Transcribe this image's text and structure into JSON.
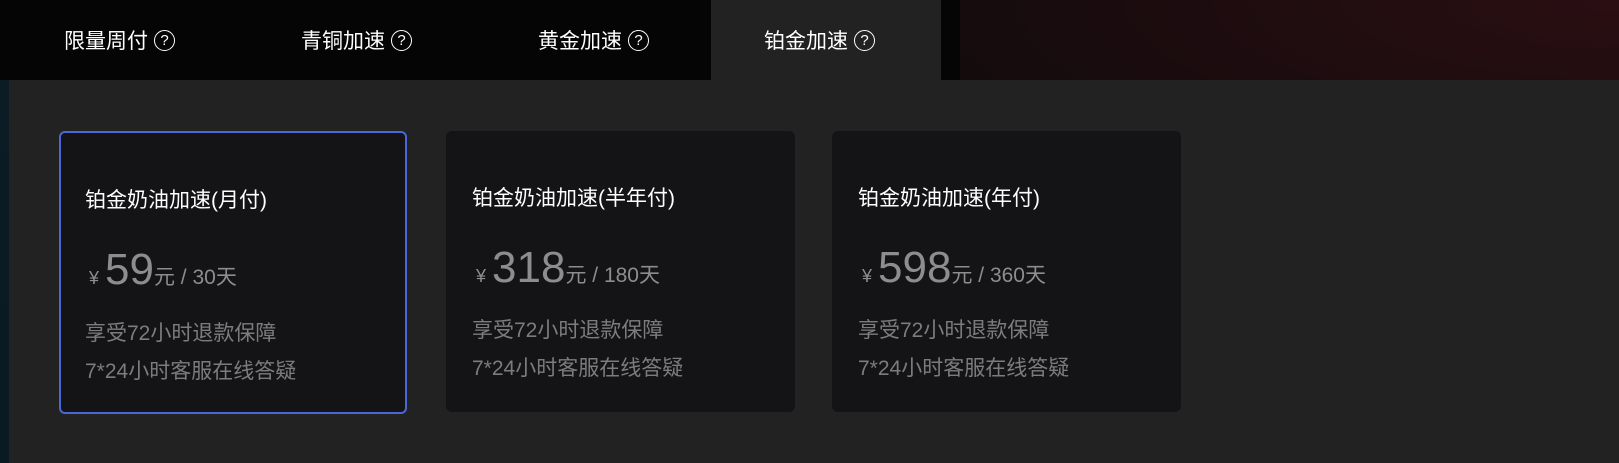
{
  "tabs": [
    {
      "label": "限量周付",
      "help": "?"
    },
    {
      "label": "青铜加速",
      "help": "?"
    },
    {
      "label": "黄金加速",
      "help": "?"
    },
    {
      "label": "铂金加速",
      "help": "?"
    }
  ],
  "active_tab": "铂金加速",
  "plans": [
    {
      "title": "铂金奶油加速(月付)",
      "currency": "¥",
      "price": "59",
      "unit": "元 / 30天",
      "features": [
        "享受72小时退款保障",
        "7*24小时客服在线答疑"
      ]
    },
    {
      "title": "铂金奶油加速(半年付)",
      "currency": "¥",
      "price": "318",
      "unit": "元 / 180天",
      "features": [
        "享受72小时退款保障",
        "7*24小时客服在线答疑"
      ]
    },
    {
      "title": "铂金奶油加速(年付)",
      "currency": "¥",
      "price": "598",
      "unit": "元 / 360天",
      "features": [
        "享受72小时退款保障",
        "7*24小时客服在线答疑"
      ]
    }
  ],
  "selected_plan": "铂金奶油加速(月付)",
  "colors": {
    "selected_border": "#4a67d8",
    "panel_bg": "#222222",
    "card_bg": "#141416"
  }
}
